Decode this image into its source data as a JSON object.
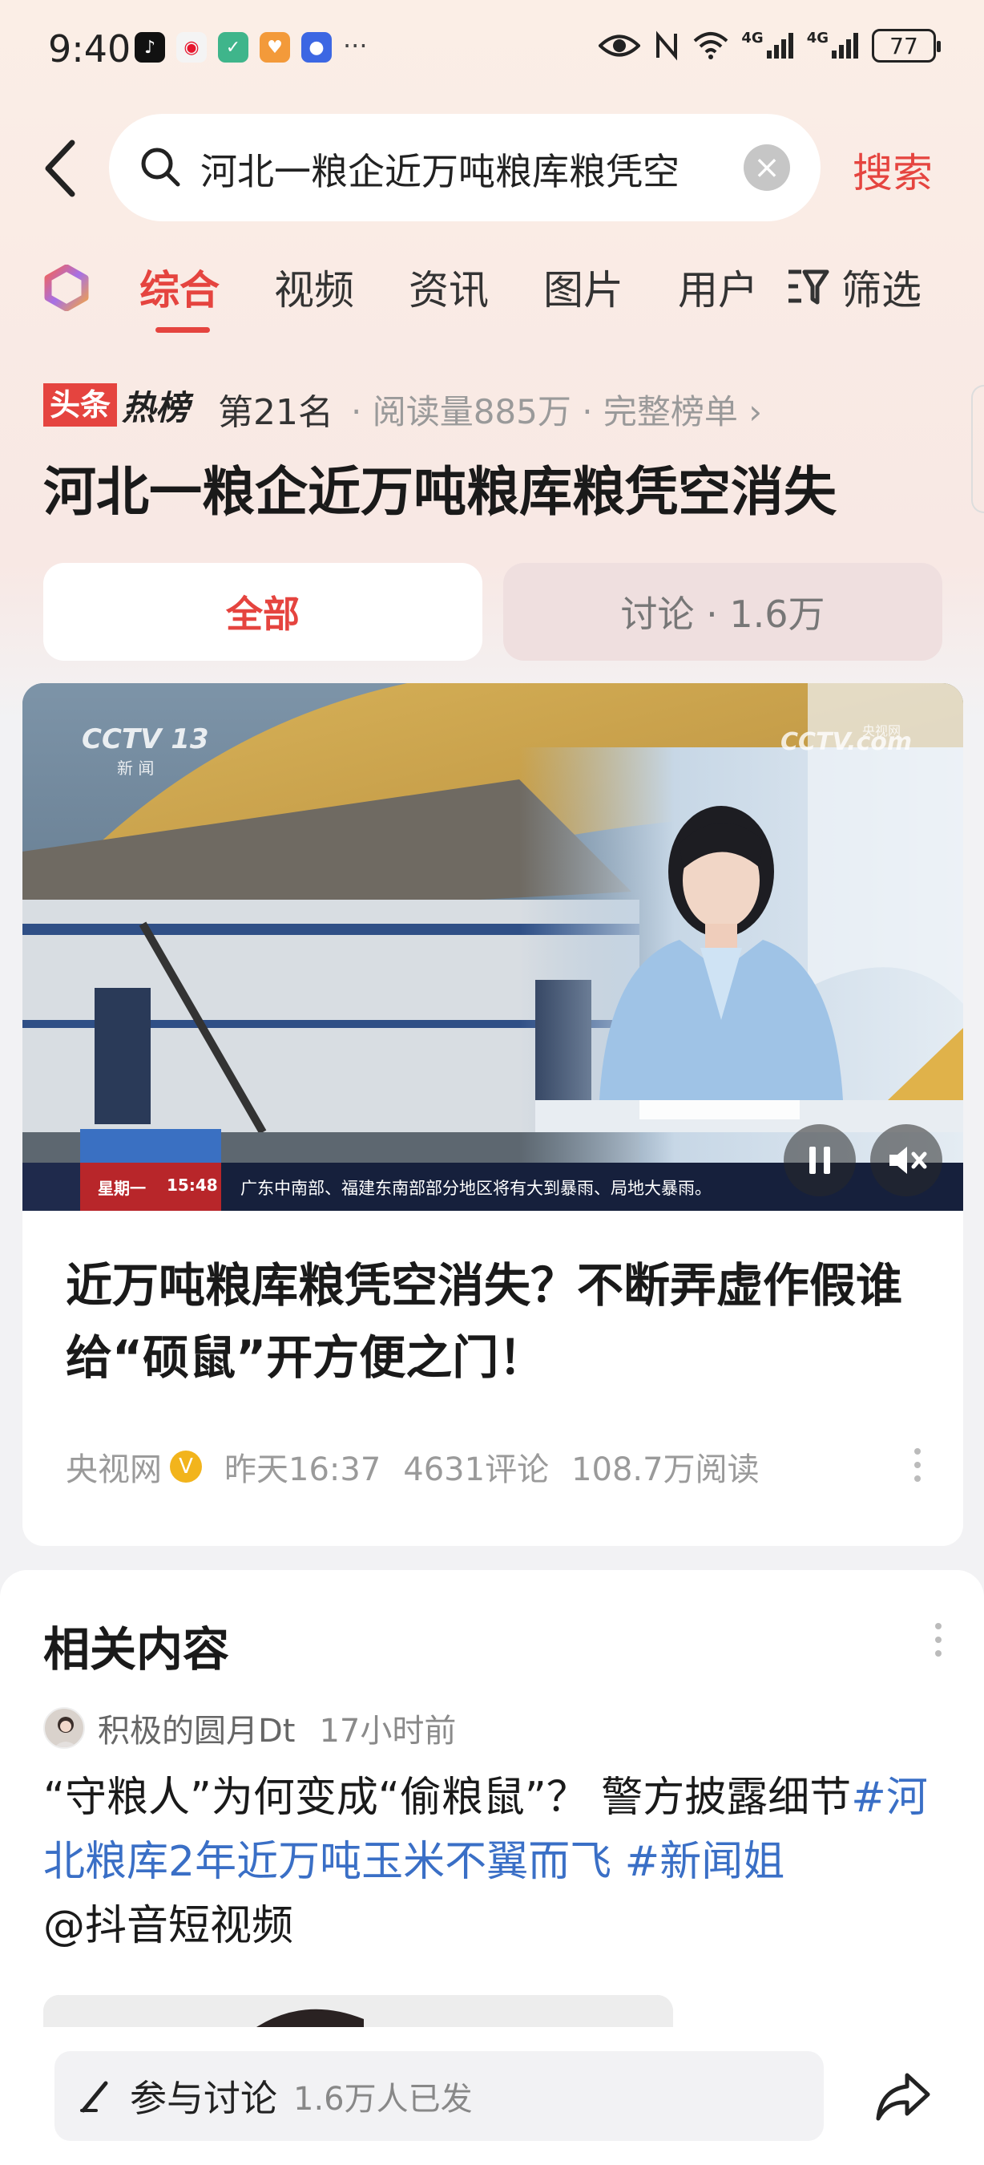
{
  "status_bar": {
    "time": "9:40",
    "more": "···",
    "network_a": "4G",
    "network_b": "4G",
    "battery": "77"
  },
  "search": {
    "back": "‹",
    "query": "河北一粮企近万吨粮库粮凭空",
    "clear": "×",
    "submit": "搜索"
  },
  "tabs": [
    {
      "label": "综合",
      "active": true
    },
    {
      "label": "视频"
    },
    {
      "label": "资讯"
    },
    {
      "label": "图片"
    },
    {
      "label": "用户"
    }
  ],
  "filter_label": "筛选",
  "hot": {
    "badge_a": "头条",
    "badge_b": "热榜",
    "rank": "第21名",
    "meta": "· 阅读量885万 · 完整榜单 ›"
  },
  "topic_title": "河北一粮企近万吨粮库粮凭空消失",
  "segments": {
    "all": "全部",
    "discussion": "讨论 · 1.6万"
  },
  "video": {
    "channel_logo": "CCTV 13",
    "channel_sub": "新 闻",
    "site_logo": "CCTV.com",
    "site_sub": "央视网",
    "weekday": "星期一",
    "clock": "15:48",
    "ticker": "广东中南部、福建东南部部分地区将有大到暴雨、局地大暴雨。"
  },
  "article": {
    "title": "近万吨粮库粮凭空消失？不断弄虚作假谁给“硕鼠”开方便之门！",
    "source": "央视网",
    "verified": "V",
    "time": "昨天16:37",
    "comments": "4631评论",
    "reads": "108.7万阅读"
  },
  "related": {
    "heading": "相关内容",
    "author": "积极的圆月Dt",
    "time": "17小时前",
    "text_plain": "“守粮人”为何变成“偷粮鼠”？ 警方披露细节",
    "tag1": "#河北粮库2年近万吨玉米不翼而飞",
    "tag2": "#新闻姐",
    "mention": "@抖音短视频"
  },
  "bottom": {
    "discuss_label": "参与讨论",
    "discuss_count": "1.6万人已发"
  },
  "colors": {
    "accent": "#e5443f",
    "tag_blue": "#3a6fc6",
    "verified_gold": "#f2b41c"
  }
}
